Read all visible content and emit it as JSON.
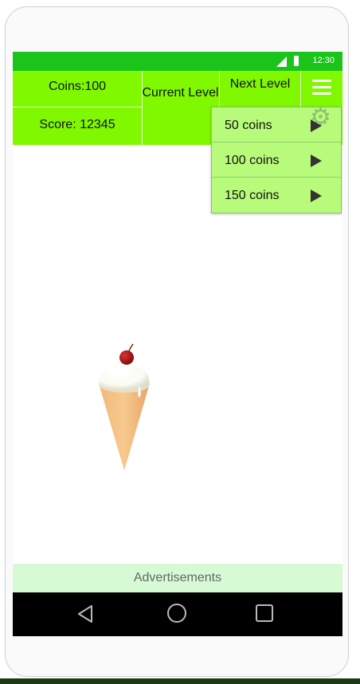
{
  "hud": {
    "coins_label": "Coins:100",
    "score_label": "Score: 12345",
    "current_level_label": "Current Level",
    "next_level_label": "Next Level"
  },
  "status": {
    "time": "12:30"
  },
  "menu": {
    "items": [
      {
        "label": "50 coins"
      },
      {
        "label": "100 coins"
      },
      {
        "label": "150 coins"
      }
    ]
  },
  "ads": {
    "label": "Advertisements"
  },
  "icons": {
    "menu": "hamburger-menu-icon",
    "settings": "gear-icon",
    "back": "back-triangle-icon",
    "home": "home-circle-icon",
    "recent": "recent-apps-square-icon"
  },
  "colors": {
    "statusbar": "#1ac41a",
    "hud": "#80f800",
    "dropdown": "#b8fb7a",
    "ads": "#d6fad4",
    "navbar": "#000000"
  }
}
